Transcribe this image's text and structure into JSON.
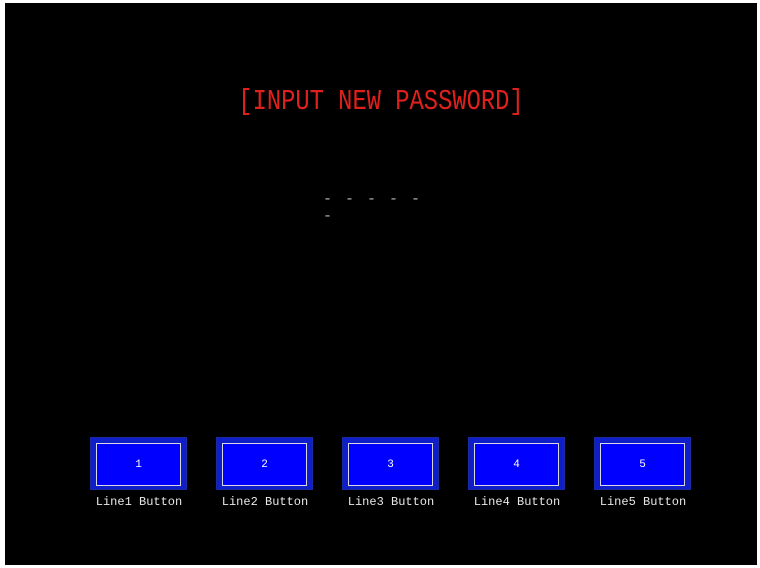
{
  "screen": {
    "title": "[INPUT NEW PASSWORD]",
    "password_mask": "- - - - - -"
  },
  "buttons": [
    {
      "label": "1",
      "caption": "Line1 Button"
    },
    {
      "label": "2",
      "caption": "Line2 Button"
    },
    {
      "label": "3",
      "caption": "Line3 Button"
    },
    {
      "label": "4",
      "caption": "Line4 Button"
    },
    {
      "label": "5",
      "caption": "Line5 Button"
    }
  ],
  "colors": {
    "background": "#000000",
    "title": "#e0201c",
    "button_fill": "#0000ff",
    "button_border": "#0f1ec8",
    "caption": "#e8e8e8"
  }
}
